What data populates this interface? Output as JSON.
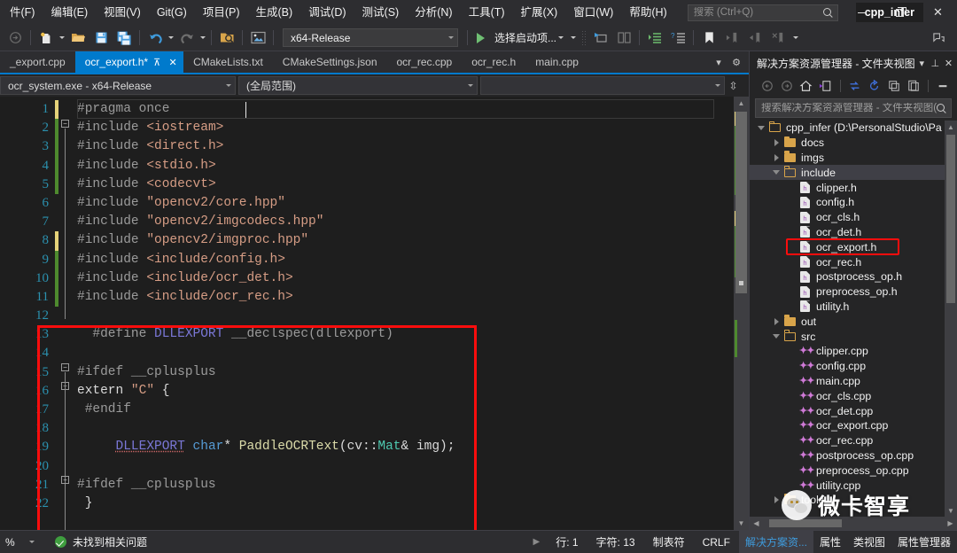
{
  "window": {
    "project_title": "cpp_infer",
    "minimize_label": "—",
    "maximize_label": "❐",
    "close_label": "✕"
  },
  "menu": {
    "items": [
      {
        "label": "件(F)",
        "name": "menu-file"
      },
      {
        "label": "编辑(E)",
        "name": "menu-edit"
      },
      {
        "label": "视图(V)",
        "name": "menu-view"
      },
      {
        "label": "Git(G)",
        "name": "menu-git"
      },
      {
        "label": "项目(P)",
        "name": "menu-project"
      },
      {
        "label": "生成(B)",
        "name": "menu-build"
      },
      {
        "label": "调试(D)",
        "name": "menu-debug"
      },
      {
        "label": "测试(S)",
        "name": "menu-test"
      },
      {
        "label": "分析(N)",
        "name": "menu-analyze"
      },
      {
        "label": "工具(T)",
        "name": "menu-tools"
      },
      {
        "label": "扩展(X)",
        "name": "menu-extensions"
      },
      {
        "label": "窗口(W)",
        "name": "menu-window"
      },
      {
        "label": "帮助(H)",
        "name": "menu-help"
      }
    ],
    "search_placeholder": "搜索 (Ctrl+Q)",
    "search_value": ""
  },
  "toolbar": {
    "config_value": "x64-Release",
    "startup_label": "选择启动项...",
    "icons": [
      "back-navigate-icon",
      "new-project-icon",
      "open-folder-icon",
      "save-icon",
      "save-all-icon",
      "undo-icon",
      "redo-icon",
      "find-in-files-icon",
      "screenshot-icon"
    ]
  },
  "tabs": {
    "items": [
      {
        "label": "_export.cpp",
        "active": false,
        "modified": false
      },
      {
        "label": "ocr_export.h*",
        "active": true,
        "modified": true
      },
      {
        "label": "CMakeLists.txt",
        "active": false,
        "modified": false
      },
      {
        "label": "CMakeSettings.json",
        "active": false,
        "modified": false
      },
      {
        "label": "ocr_rec.cpp",
        "active": false,
        "modified": false
      },
      {
        "label": "ocr_rec.h",
        "active": false,
        "modified": false
      },
      {
        "label": "main.cpp",
        "active": false,
        "modified": false
      }
    ],
    "pin_label": "⊼",
    "close_label": "✕",
    "overflow_label": "▾",
    "settings_label": "⚙"
  },
  "navbar": {
    "project_scope": "ocr_system.exe - x64-Release",
    "type_scope": "(全局范围)",
    "member_scope": "",
    "split_label": "⇳"
  },
  "editor": {
    "lines": [
      {
        "n": "1",
        "change": "y",
        "segments": [
          {
            "t": "#pragma once",
            "c": "k-pp"
          }
        ]
      },
      {
        "n": "2",
        "change": "g",
        "segments": [
          {
            "t": "#include ",
            "c": "k-pp"
          },
          {
            "t": "<iostream>",
            "c": "k-inc"
          }
        ]
      },
      {
        "n": "3",
        "change": "g",
        "segments": [
          {
            "t": "#include ",
            "c": "k-pp"
          },
          {
            "t": "<direct.h>",
            "c": "k-inc"
          }
        ]
      },
      {
        "n": "4",
        "change": "g",
        "segments": [
          {
            "t": "#include ",
            "c": "k-pp"
          },
          {
            "t": "<stdio.h>",
            "c": "k-inc"
          }
        ]
      },
      {
        "n": "5",
        "change": "g",
        "segments": [
          {
            "t": "#include ",
            "c": "k-pp"
          },
          {
            "t": "<codecvt>",
            "c": "k-inc"
          }
        ]
      },
      {
        "n": "6",
        "change": "n",
        "segments": [
          {
            "t": "#include ",
            "c": "k-pp"
          },
          {
            "t": "\"opencv2/core.hpp\"",
            "c": "k-str"
          }
        ]
      },
      {
        "n": "7",
        "change": "n",
        "segments": [
          {
            "t": "#include ",
            "c": "k-pp"
          },
          {
            "t": "\"opencv2/imgcodecs.hpp\"",
            "c": "k-str"
          }
        ]
      },
      {
        "n": "8",
        "change": "y",
        "segments": [
          {
            "t": "#include ",
            "c": "k-pp"
          },
          {
            "t": "\"opencv2/imgproc.hpp\"",
            "c": "k-str"
          }
        ]
      },
      {
        "n": "9",
        "change": "g",
        "segments": [
          {
            "t": "#include ",
            "c": "k-pp"
          },
          {
            "t": "<include/config.h>",
            "c": "k-inc"
          }
        ]
      },
      {
        "n": "10",
        "change": "g",
        "segments": [
          {
            "t": "#include ",
            "c": "k-pp"
          },
          {
            "t": "<include/ocr_det.h>",
            "c": "k-inc"
          }
        ]
      },
      {
        "n": "11",
        "change": "g",
        "segments": [
          {
            "t": "#include ",
            "c": "k-pp"
          },
          {
            "t": "<include/ocr_rec.h>",
            "c": "k-inc"
          }
        ]
      },
      {
        "n": "12",
        "change": "n",
        "segments": [
          {
            "t": "",
            "c": "k-plain"
          }
        ]
      },
      {
        "n": "13",
        "change": "n",
        "segments": [
          {
            "t": "  #define ",
            "c": "k-pp"
          },
          {
            "t": "DLLEXPORT",
            "c": "k-macro"
          },
          {
            "t": " __declspec",
            "c": "k-pp"
          },
          {
            "t": "(dllexport)",
            "c": "k-pp"
          }
        ]
      },
      {
        "n": "14",
        "change": "n",
        "segments": [
          {
            "t": "",
            "c": "k-plain"
          }
        ]
      },
      {
        "n": "15",
        "change": "n",
        "segments": [
          {
            "t": "#ifdef __cplusplus",
            "c": "k-pp"
          }
        ]
      },
      {
        "n": "16",
        "change": "n",
        "segments": [
          {
            "t": "extern ",
            "c": "k-plain"
          },
          {
            "t": "\"C\"",
            "c": "k-str"
          },
          {
            "t": " {",
            "c": "k-plain"
          }
        ]
      },
      {
        "n": "17",
        "change": "n",
        "segments": [
          {
            "t": " #endif",
            "c": "k-pp"
          }
        ]
      },
      {
        "n": "18",
        "change": "n",
        "segments": [
          {
            "t": "",
            "c": "k-plain"
          }
        ]
      },
      {
        "n": "19",
        "change": "n",
        "segments": [
          {
            "t": "     ",
            "c": "k-plain"
          },
          {
            "t": "DLLEXPORT",
            "c": "k-macro underline-sq"
          },
          {
            "t": " ",
            "c": "k-plain"
          },
          {
            "t": "char",
            "c": "k-kw"
          },
          {
            "t": "* ",
            "c": "k-plain"
          },
          {
            "t": "PaddleOCRText",
            "c": "k-fn"
          },
          {
            "t": "(cv::",
            "c": "k-plain"
          },
          {
            "t": "Mat",
            "c": "k-type"
          },
          {
            "t": "& img);",
            "c": "k-plain"
          }
        ]
      },
      {
        "n": "20",
        "change": "n",
        "segments": [
          {
            "t": "",
            "c": "k-plain"
          }
        ]
      },
      {
        "n": "21",
        "change": "n",
        "segments": [
          {
            "t": "#ifdef __cplusplus",
            "c": "k-pp"
          }
        ]
      },
      {
        "n": "22",
        "change": "n",
        "segments": [
          {
            "t": " }",
            "c": "k-plain"
          }
        ]
      }
    ],
    "highlight_note": "red-annotation-box"
  },
  "solution_explorer": {
    "title": "解决方案资源管理器 - 文件夹视图",
    "dropdown_label": "▾",
    "pin_label": "⊥",
    "close_label": "✕",
    "search_placeholder": "搜索解决方案资源管理器 - 文件夹视图(Ct",
    "search_value": "",
    "toolbar_icons": [
      "back-icon",
      "forward-icon",
      "home-icon",
      "switch-view-icon",
      "sync-icon",
      "refresh-icon",
      "collapse-all-icon",
      "show-all-files-icon",
      "properties-icon"
    ],
    "tree": [
      {
        "label": "cpp_infer (D:\\PersonalStudio\\Pa",
        "type": "folder-open",
        "indent": 0,
        "twist": "down",
        "selected": false,
        "highlight": false
      },
      {
        "label": "docs",
        "type": "folder",
        "indent": 1,
        "twist": "right",
        "selected": false,
        "highlight": false
      },
      {
        "label": "imgs",
        "type": "folder",
        "indent": 1,
        "twist": "right",
        "selected": false,
        "highlight": false
      },
      {
        "label": "include",
        "type": "folder-open",
        "indent": 1,
        "twist": "down",
        "selected": true,
        "highlight": false
      },
      {
        "label": "clipper.h",
        "type": "header",
        "indent": 2,
        "twist": "none",
        "selected": false,
        "highlight": false
      },
      {
        "label": "config.h",
        "type": "header",
        "indent": 2,
        "twist": "none",
        "selected": false,
        "highlight": false
      },
      {
        "label": "ocr_cls.h",
        "type": "header",
        "indent": 2,
        "twist": "none",
        "selected": false,
        "highlight": false
      },
      {
        "label": "ocr_det.h",
        "type": "header",
        "indent": 2,
        "twist": "none",
        "selected": false,
        "highlight": false
      },
      {
        "label": "ocr_export.h",
        "type": "header",
        "indent": 2,
        "twist": "none",
        "selected": false,
        "highlight": true
      },
      {
        "label": "ocr_rec.h",
        "type": "header",
        "indent": 2,
        "twist": "none",
        "selected": false,
        "highlight": false
      },
      {
        "label": "postprocess_op.h",
        "type": "header",
        "indent": 2,
        "twist": "none",
        "selected": false,
        "highlight": false
      },
      {
        "label": "preprocess_op.h",
        "type": "header",
        "indent": 2,
        "twist": "none",
        "selected": false,
        "highlight": false
      },
      {
        "label": "utility.h",
        "type": "header",
        "indent": 2,
        "twist": "none",
        "selected": false,
        "highlight": false
      },
      {
        "label": "out",
        "type": "folder",
        "indent": 1,
        "twist": "right",
        "selected": false,
        "highlight": false
      },
      {
        "label": "src",
        "type": "folder-open",
        "indent": 1,
        "twist": "down",
        "selected": false,
        "highlight": false
      },
      {
        "label": "clipper.cpp",
        "type": "cpp",
        "indent": 2,
        "twist": "none",
        "selected": false,
        "highlight": false
      },
      {
        "label": "config.cpp",
        "type": "cpp",
        "indent": 2,
        "twist": "none",
        "selected": false,
        "highlight": false
      },
      {
        "label": "main.cpp",
        "type": "cpp",
        "indent": 2,
        "twist": "none",
        "selected": false,
        "highlight": false
      },
      {
        "label": "ocr_cls.cpp",
        "type": "cpp",
        "indent": 2,
        "twist": "none",
        "selected": false,
        "highlight": false
      },
      {
        "label": "ocr_det.cpp",
        "type": "cpp",
        "indent": 2,
        "twist": "none",
        "selected": false,
        "highlight": false
      },
      {
        "label": "ocr_export.cpp",
        "type": "cpp",
        "indent": 2,
        "twist": "none",
        "selected": false,
        "highlight": false
      },
      {
        "label": "ocr_rec.cpp",
        "type": "cpp",
        "indent": 2,
        "twist": "none",
        "selected": false,
        "highlight": false
      },
      {
        "label": "postprocess_op.cpp",
        "type": "cpp",
        "indent": 2,
        "twist": "none",
        "selected": false,
        "highlight": false
      },
      {
        "label": "preprocess_op.cpp",
        "type": "cpp",
        "indent": 2,
        "twist": "none",
        "selected": false,
        "highlight": false
      },
      {
        "label": "utility.cpp",
        "type": "cpp",
        "indent": 2,
        "twist": "none",
        "selected": false,
        "highlight": false
      },
      {
        "label": "tools",
        "type": "folder",
        "indent": 1,
        "twist": "right",
        "selected": false,
        "highlight": false
      }
    ]
  },
  "statusbar": {
    "zoom": "%",
    "issue_text": "未找到相关问题",
    "line_label": "行: 1",
    "char_label": "字符: 13",
    "tab_label": "制表符",
    "eol_label": "CRLF",
    "panel_tabs": [
      {
        "label": "解决方案资...",
        "active": true
      },
      {
        "label": "属性",
        "active": false
      },
      {
        "label": "类视图",
        "active": false
      },
      {
        "label": "属性管理器",
        "active": false
      }
    ]
  },
  "watermark": {
    "text": "微卡智享"
  }
}
